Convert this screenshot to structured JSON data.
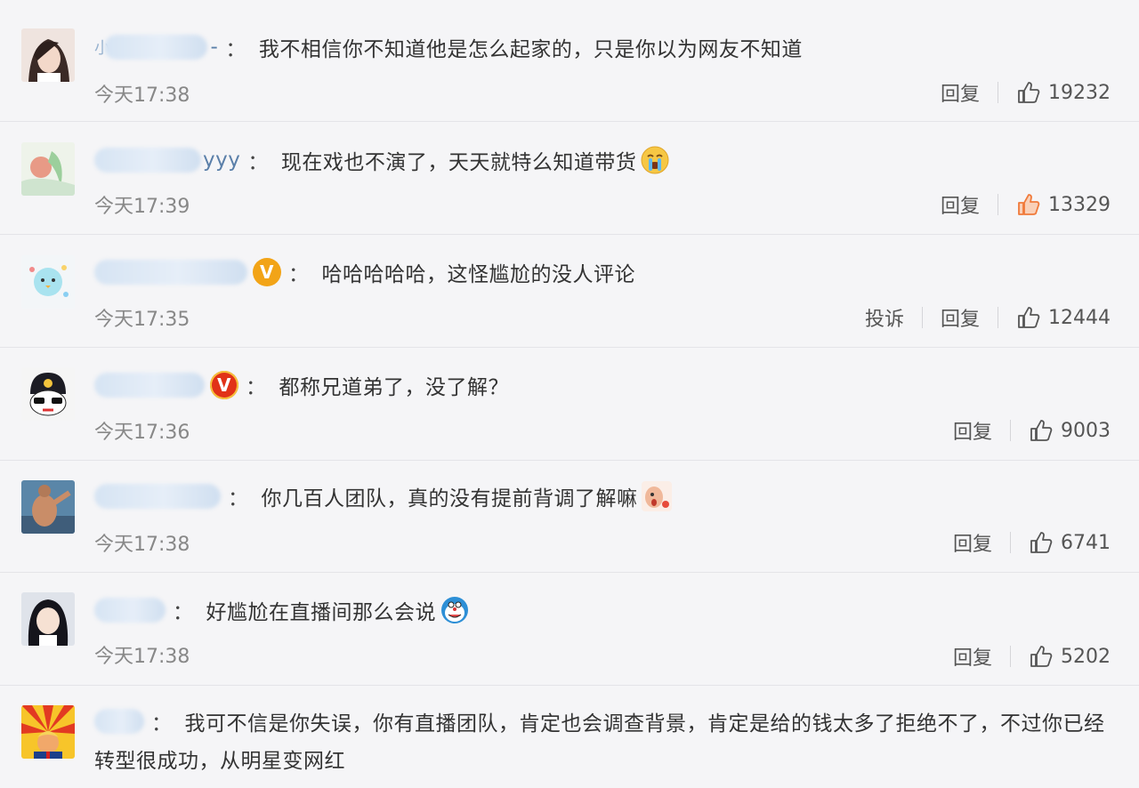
{
  "comments": [
    {
      "text": "我不相信你不知道他是怎么起家的，只是你以为网友不知道",
      "time": "今天17:38",
      "reply": "回复",
      "likes": "19232",
      "username_fragment": "小",
      "username_tail": "-"
    },
    {
      "text": "现在戏也不演了，天天就特么知道带货",
      "time": "今天17:39",
      "reply": "回复",
      "likes": "13329",
      "username_fragment": "yyy"
    },
    {
      "text": "哈哈哈哈哈，这怪尴尬的没人评论",
      "time": "今天17:35",
      "report": "投诉",
      "reply": "回复",
      "likes": "12444"
    },
    {
      "text": "都称兄道弟了，没了解？",
      "time": "今天17:36",
      "reply": "回复",
      "likes": "9003"
    },
    {
      "text": "你几百人团队，真的没有提前背调了解嘛",
      "time": "今天17:38",
      "reply": "回复",
      "likes": "6741"
    },
    {
      "text": "好尴尬在直播间那么会说",
      "time": "今天17:38",
      "reply": "回复",
      "likes": "5202"
    },
    {
      "text_line1": "我可不信是你失误，你有直播团队，肯定也会调查背景，肯定是给的钱太多了拒绝不了，不过你已经",
      "text_line2": "转型很成功，从明星变网红"
    }
  ],
  "colon": "：",
  "badges": {
    "verified": "V"
  },
  "colors": {
    "background": "#f5f5f7",
    "time": "#888888",
    "like_highlight": "#f07a3a",
    "verified_orange": "#f2a417",
    "verified_red": "#e13218"
  },
  "icons": {
    "like": "thumbs-up-icon",
    "emoji": "emoji-icon"
  }
}
